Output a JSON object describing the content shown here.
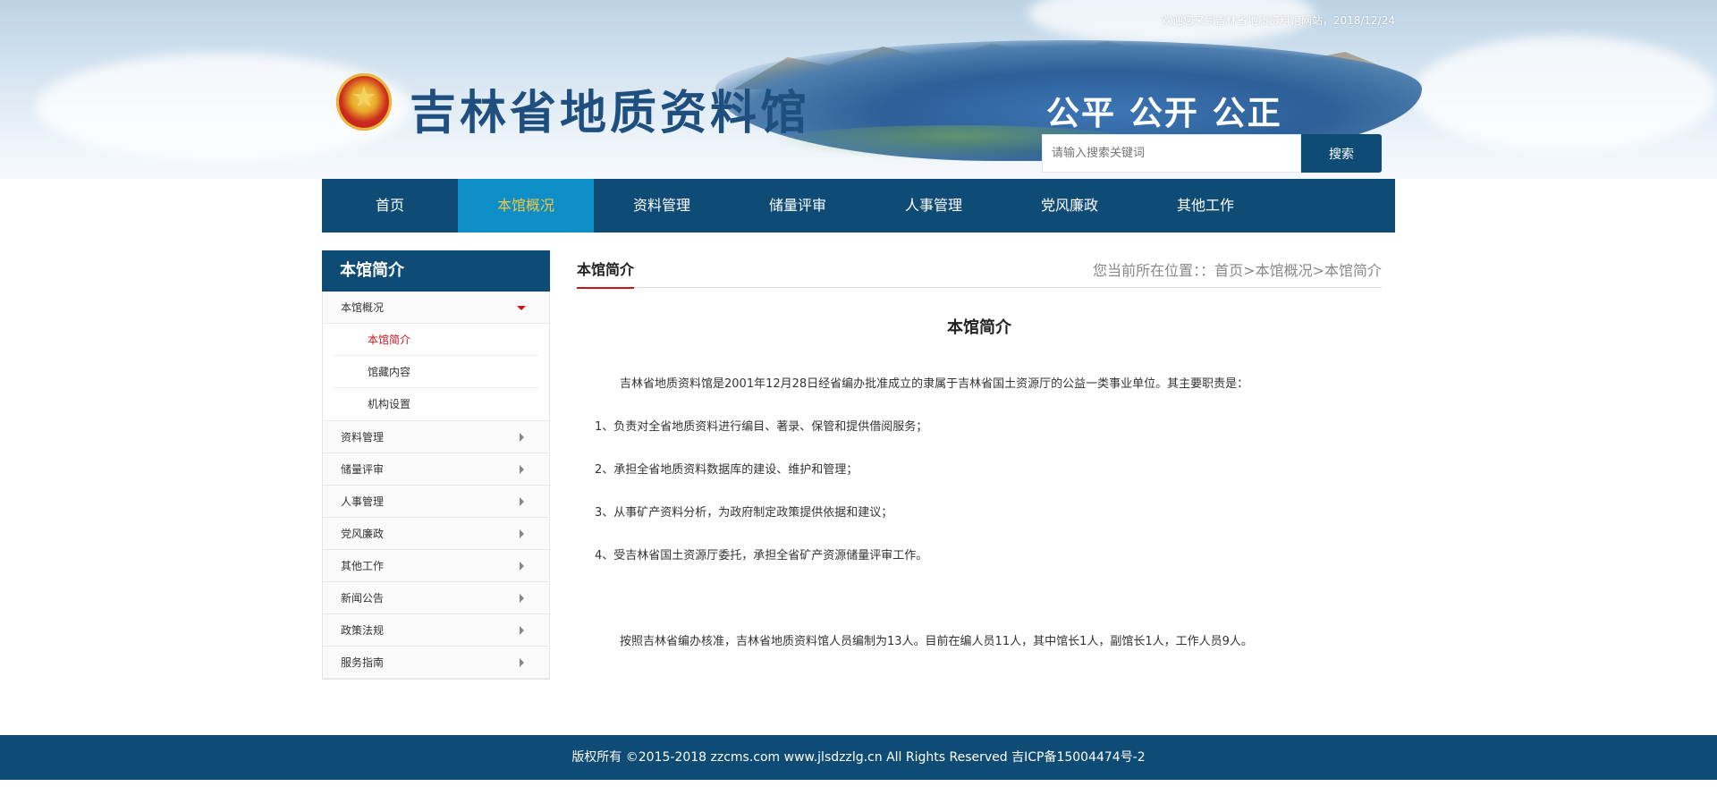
{
  "header": {
    "welcome_text": "欢迎您来到吉林省地质资料馆网站，2018/12/24",
    "site_title": "吉林省地质资料馆",
    "slogan": "公平 公开 公正",
    "search_placeholder": "请输入搜索关键词",
    "search_button": "搜索"
  },
  "nav": {
    "items": [
      {
        "label": "首页"
      },
      {
        "label": "本馆概况"
      },
      {
        "label": "资料管理"
      },
      {
        "label": "储量评审"
      },
      {
        "label": "人事管理"
      },
      {
        "label": "党风廉政"
      },
      {
        "label": "其他工作"
      }
    ],
    "active_index": 1
  },
  "sidebar": {
    "title": "本馆简介",
    "expanded": {
      "label": "本馆概况",
      "children": [
        {
          "label": "本馆简介",
          "active": true
        },
        {
          "label": "馆藏内容"
        },
        {
          "label": "机构设置"
        }
      ]
    },
    "items": [
      {
        "label": "资料管理"
      },
      {
        "label": "储量评审"
      },
      {
        "label": "人事管理"
      },
      {
        "label": "党风廉政"
      },
      {
        "label": "其他工作"
      },
      {
        "label": "新闻公告"
      },
      {
        "label": "政策法规"
      },
      {
        "label": "服务指南"
      }
    ]
  },
  "main": {
    "section_title": "本馆简介",
    "location": "您当前所在位置：：首页>本馆概况>本馆简介",
    "article_title": "本馆简介",
    "intro": "吉林省地质资料馆是2001年12月28日经省编办批准成立的隶属于吉林省国土资源厅的公益一类事业单位。其主要职责是：",
    "duties": [
      "1、负责对全省地质资料进行编目、著录、保管和提供借阅服务；",
      "2、承担全省地质资料数据库的建设、维护和管理；",
      "3、从事矿产资料分析，为政府制定政策提供依据和建议；",
      "4、受吉林省国土资源厅委托，承担全省矿产资源储量评审工作。"
    ],
    "staff": "按照吉林省编办核准，吉林省地质资料馆人员编制为13人。目前在编人员11人，其中馆长1人，副馆长1人，工作人员9人。"
  },
  "footer": {
    "copyright": "版权所有 ©2015-2018 zzcms.com www.jlsdzzlg.cn All Rights Reserved 吉ICP备15004474号-2"
  },
  "colors": {
    "primary": "#0e4b75",
    "nav_active_bg": "#0e8ec6",
    "nav_active_text": "#f3c640",
    "accent_red": "#c8161d"
  }
}
